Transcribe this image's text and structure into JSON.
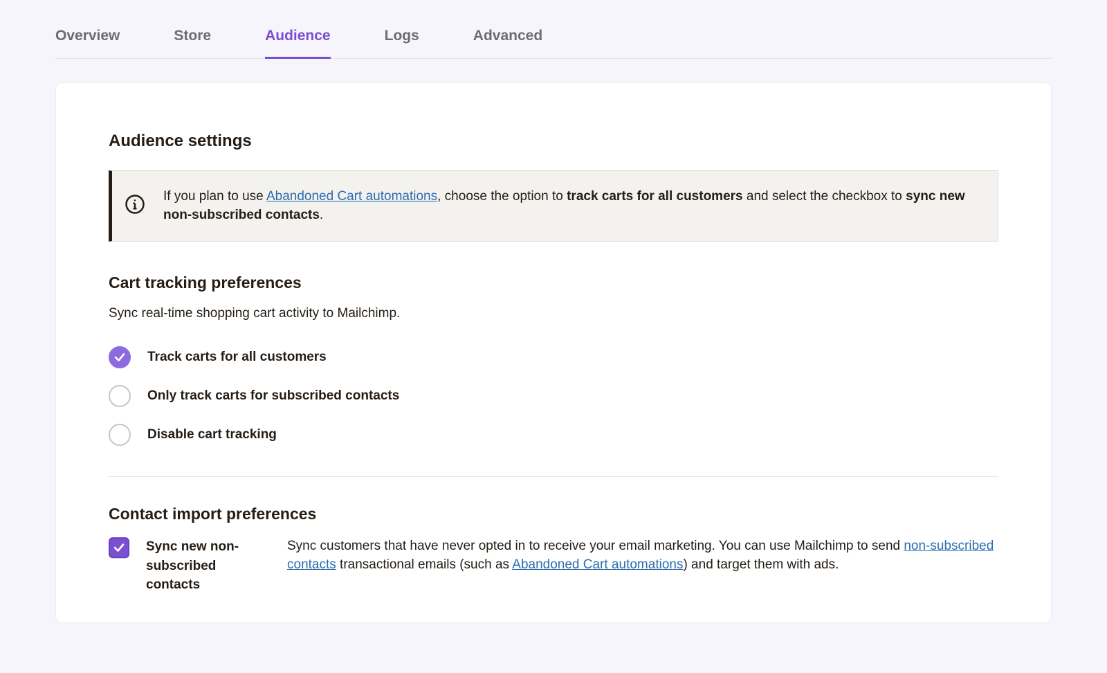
{
  "tabs": [
    {
      "label": "Overview",
      "active": false
    },
    {
      "label": "Store",
      "active": false
    },
    {
      "label": "Audience",
      "active": true
    },
    {
      "label": "Logs",
      "active": false
    },
    {
      "label": "Advanced",
      "active": false
    }
  ],
  "section_title": "Audience settings",
  "info_banner": {
    "prefix": "If you plan to use ",
    "link": "Abandoned Cart automations",
    "mid1": ", choose the option to ",
    "bold1": "track carts for all customers",
    "mid2": " and select the checkbox to ",
    "bold2": "sync new non-subscribed contacts",
    "suffix": "."
  },
  "cart_tracking": {
    "title": "Cart tracking preferences",
    "desc": "Sync real-time shopping cart activity to Mailchimp.",
    "options": [
      {
        "label": "Track carts for all customers",
        "selected": true
      },
      {
        "label": "Only track carts for subscribed contacts",
        "selected": false
      },
      {
        "label": "Disable cart tracking",
        "selected": false
      }
    ]
  },
  "contact_import": {
    "title": "Contact import preferences",
    "checkbox_label": "Sync new non-subscribed contacts",
    "checkbox_checked": true,
    "desc_prefix": "Sync customers that have never opted in to receive your email marketing. You can use Mailchimp to send ",
    "link1": "non-subscribed contacts",
    "desc_mid": " transactional emails (such as ",
    "link2": "Abandoned Cart automations",
    "desc_suffix": ") and target them with ads."
  }
}
